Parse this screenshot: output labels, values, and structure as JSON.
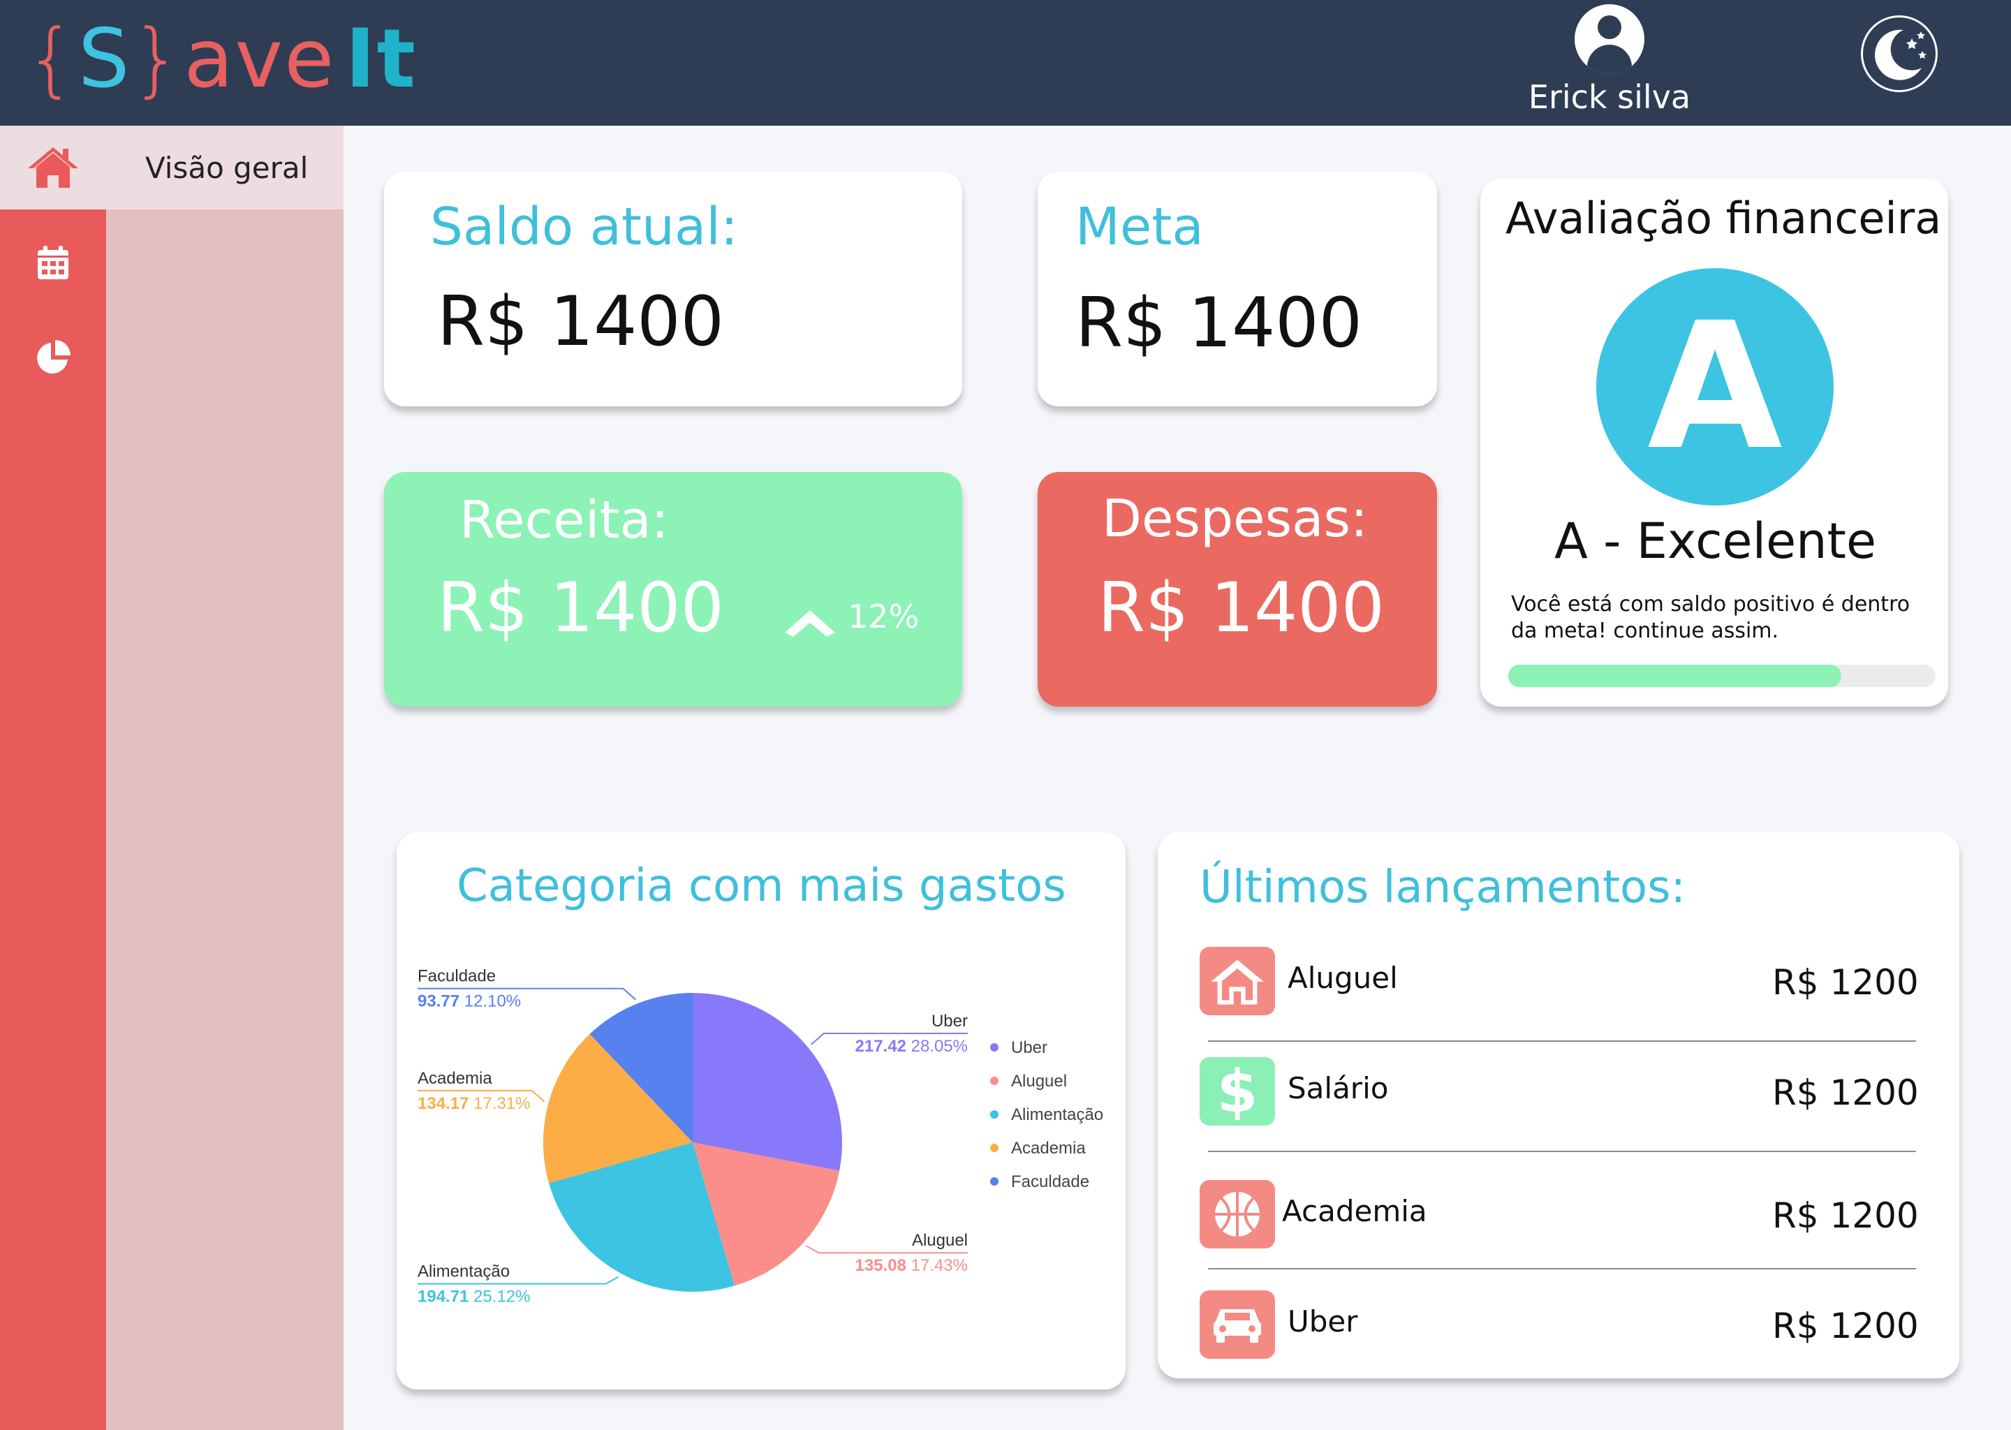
{
  "brand": {
    "logo_open": "{",
    "logo_s": "S",
    "logo_close": "}",
    "logo_ave": "ave",
    "logo_it": "It"
  },
  "user": {
    "name": "Erick silva"
  },
  "sidebar": {
    "items": [
      {
        "icon": "home-icon",
        "label": "Visão geral",
        "active": true
      },
      {
        "icon": "calendar-icon"
      },
      {
        "icon": "pie-chart-icon"
      }
    ]
  },
  "cards": {
    "saldo": {
      "title": "Saldo atual:",
      "value": "R$ 1400"
    },
    "meta": {
      "title": "Meta",
      "value": "R$ 1400"
    },
    "receita": {
      "title": "Receita:",
      "value": "R$ 1400",
      "change": "12%",
      "trend": "up"
    },
    "despesas": {
      "title": "Despesas:",
      "value": "R$ 1400"
    },
    "avaliacao": {
      "title": "Avaliação financeira",
      "grade": "A",
      "grade_label": "A - Excelente",
      "message_line1": "Você está com saldo positivo é dentro",
      "message_line2": "da meta! continue assim.",
      "progress": 0.78
    }
  },
  "category_panel": {
    "title": "Categoria com mais gastos"
  },
  "chart_data": {
    "type": "pie",
    "slices": [
      {
        "name": "Uber",
        "value": 217.42,
        "percent": "28.05%",
        "color": "#8878fa"
      },
      {
        "name": "Aluguel",
        "value": 135.08,
        "percent": "17.43%",
        "color": "#fb8e8a"
      },
      {
        "name": "Alimentação",
        "value": 194.71,
        "percent": "25.12%",
        "color": "#3cc4e2"
      },
      {
        "name": "Academia",
        "value": 134.17,
        "percent": "17.31%",
        "color": "#fdad46"
      },
      {
        "name": "Faculdade",
        "value": 93.77,
        "percent": "12.10%",
        "color": "#5681ee"
      }
    ],
    "legend": [
      "Uber",
      "Aluguel",
      "Alimentação",
      "Academia",
      "Faculdade"
    ],
    "legend_position": "right"
  },
  "launches": {
    "title": "Últimos lançamentos:",
    "rows": [
      {
        "icon": "home-icon",
        "name": "Aluguel",
        "value": "R$ 1200",
        "color": "#f48a84"
      },
      {
        "icon": "dollar-icon",
        "name": "Salário",
        "value": "R$ 1200",
        "color": "#8bf0b6"
      },
      {
        "icon": "basketball-icon",
        "name": "Academia",
        "value": "R$ 1200",
        "color": "#f48a84"
      },
      {
        "icon": "car-icon",
        "name": "Uber",
        "value": "R$ 1200",
        "color": "#f48a84"
      }
    ]
  },
  "colors": {
    "topbar": "#2e3d54",
    "rail": "#e95a5a",
    "subnav": "#e4bfc0",
    "accent": "#3fbfdc",
    "receita": "#8cf2b6",
    "despesas": "#ea6961"
  }
}
